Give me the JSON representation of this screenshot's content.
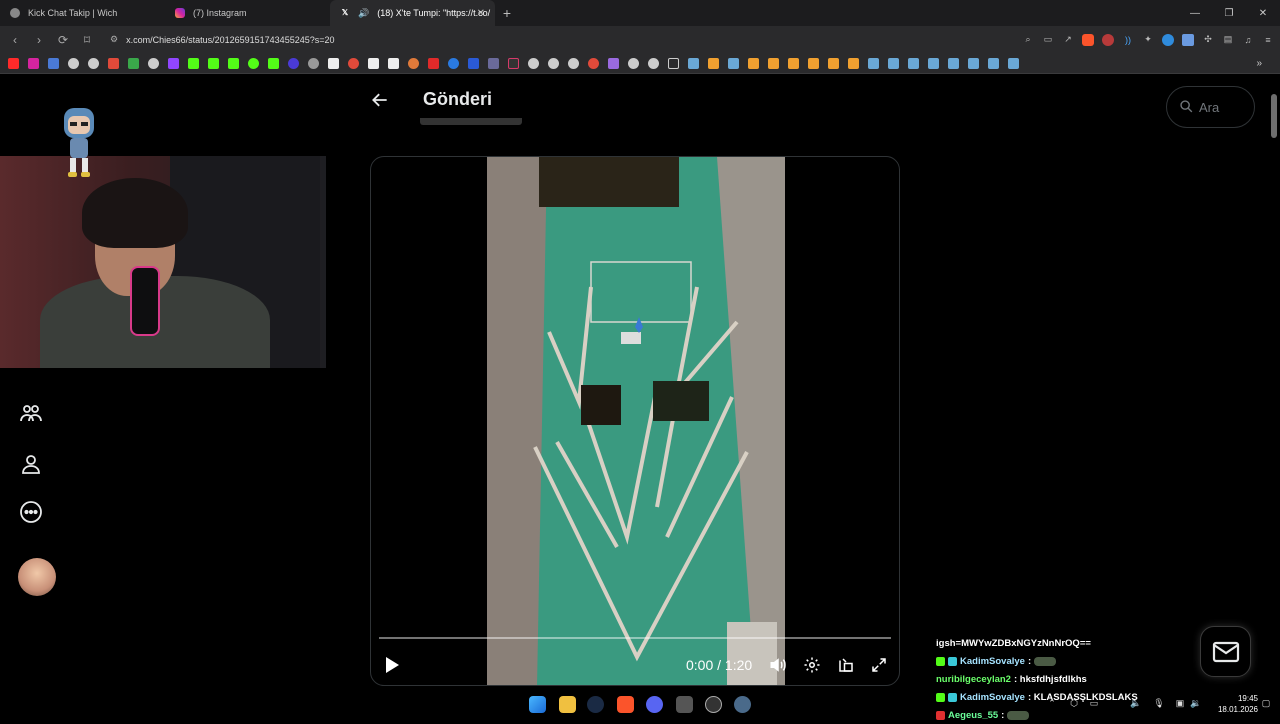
{
  "browser": {
    "tabs": [
      {
        "title": "Kick Chat Takip | Wich",
        "active": false
      },
      {
        "title": "(7) Instagram",
        "active": false
      },
      {
        "title": "(18) X'te Tumpi: \"https://t.co/",
        "active": true
      }
    ],
    "url": "x.com/Chies66/status/2012659151743455245?s=20"
  },
  "page": {
    "title": "Gönderi",
    "search_placeholder": "Ara"
  },
  "video": {
    "current_time": "0:00",
    "separator": "/",
    "duration": "1:20",
    "progress": 0
  },
  "chat": {
    "lines": [
      {
        "user": "",
        "text": "igsh=MWYwZDBxNGYzNnNrOQ==",
        "user_color": "#ffffff",
        "emote": false
      },
      {
        "user": "KadimSovalye",
        "text": ":",
        "user_color": "#a6e3ff",
        "emote": true
      },
      {
        "user": "nuribilgeceylan2",
        "text": ": hksfdhjsfdlkhs",
        "user_color": "#6bff6b",
        "emote": false
      },
      {
        "user": "KadimSovalye",
        "text": ": KLASDASŞLKDSLAKŞ",
        "user_color": "#a6e3ff",
        "emote": false
      },
      {
        "user": "Aegeus_55",
        "text": ":",
        "user_color": "#6bff9a",
        "emote": true
      }
    ]
  },
  "taskbar": {
    "time": "19:45",
    "date": "18.01.2026"
  },
  "colors": {
    "background": "#000000",
    "text_primary": "#e7e9ea",
    "border": "#2f3336",
    "accent": "#1d9bf0"
  }
}
